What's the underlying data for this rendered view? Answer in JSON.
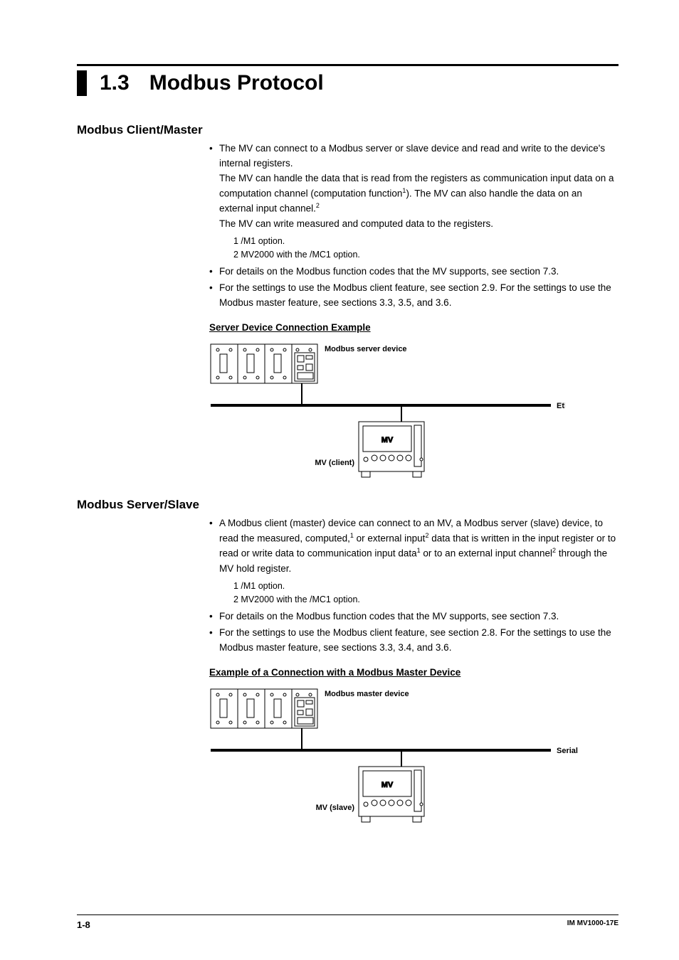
{
  "heading": {
    "number": "1.3",
    "title": "Modbus Protocol"
  },
  "sectionA": {
    "title": "Modbus Client/Master",
    "bullet1_a": "The MV can connect to a Modbus server or slave device and read and write to the device's internal registers.",
    "bullet1_b_pre": "The MV can handle the data that is read from the registers as communication input data on a computation channel (computation function",
    "bullet1_b_mid": "). The MV can also handle the data on an external input channel.",
    "bullet1_c": "The MV can write measured and computed data to the registers.",
    "note1": "1   /M1 option.",
    "note2": "2   MV2000 with the /MC1 option.",
    "bullet2": "For details on the Modbus function codes that the MV supports, see section 7.3.",
    "bullet3": "For the settings to use the Modbus client feature, see section 2.9. For the settings to use the Modbus master feature, see sections 3.3, 3.5, and 3.6.",
    "diagram_title": "Server Device Connection Example",
    "labels": {
      "top": "Modbus server device",
      "network": "Ethernet",
      "device": "MV",
      "role": "MV (client)"
    }
  },
  "sectionB": {
    "title": "Modbus Server/Slave",
    "bullet1_a": "A Modbus client (master) device can connect to an MV, a Modbus server (slave) device, to read the measured, computed,",
    "bullet1_b": " or external input",
    "bullet1_c": " data that is written in the input register or to read or write data to communication input data",
    "bullet1_d": " or to an external input channel",
    "bullet1_e": " through the MV hold register.",
    "note1": "1   /M1 option.",
    "note2": "2   MV2000 with the /MC1 option.",
    "bullet2": "For details on the Modbus function codes that the MV supports, see section 7.3.",
    "bullet3": "For the settings to use the Modbus client feature, see section 2.8. For the settings to use the Modbus master feature, see sections 3.3, 3.4, and 3.6.",
    "diagram_title": "Example of a Connection with a Modbus Master Device",
    "labels": {
      "top": "Modbus master device",
      "network": "Serial communication",
      "device": "MV",
      "role": "MV (slave)"
    }
  },
  "footer": {
    "page": "1-8",
    "doc": "IM MV1000-17E"
  }
}
